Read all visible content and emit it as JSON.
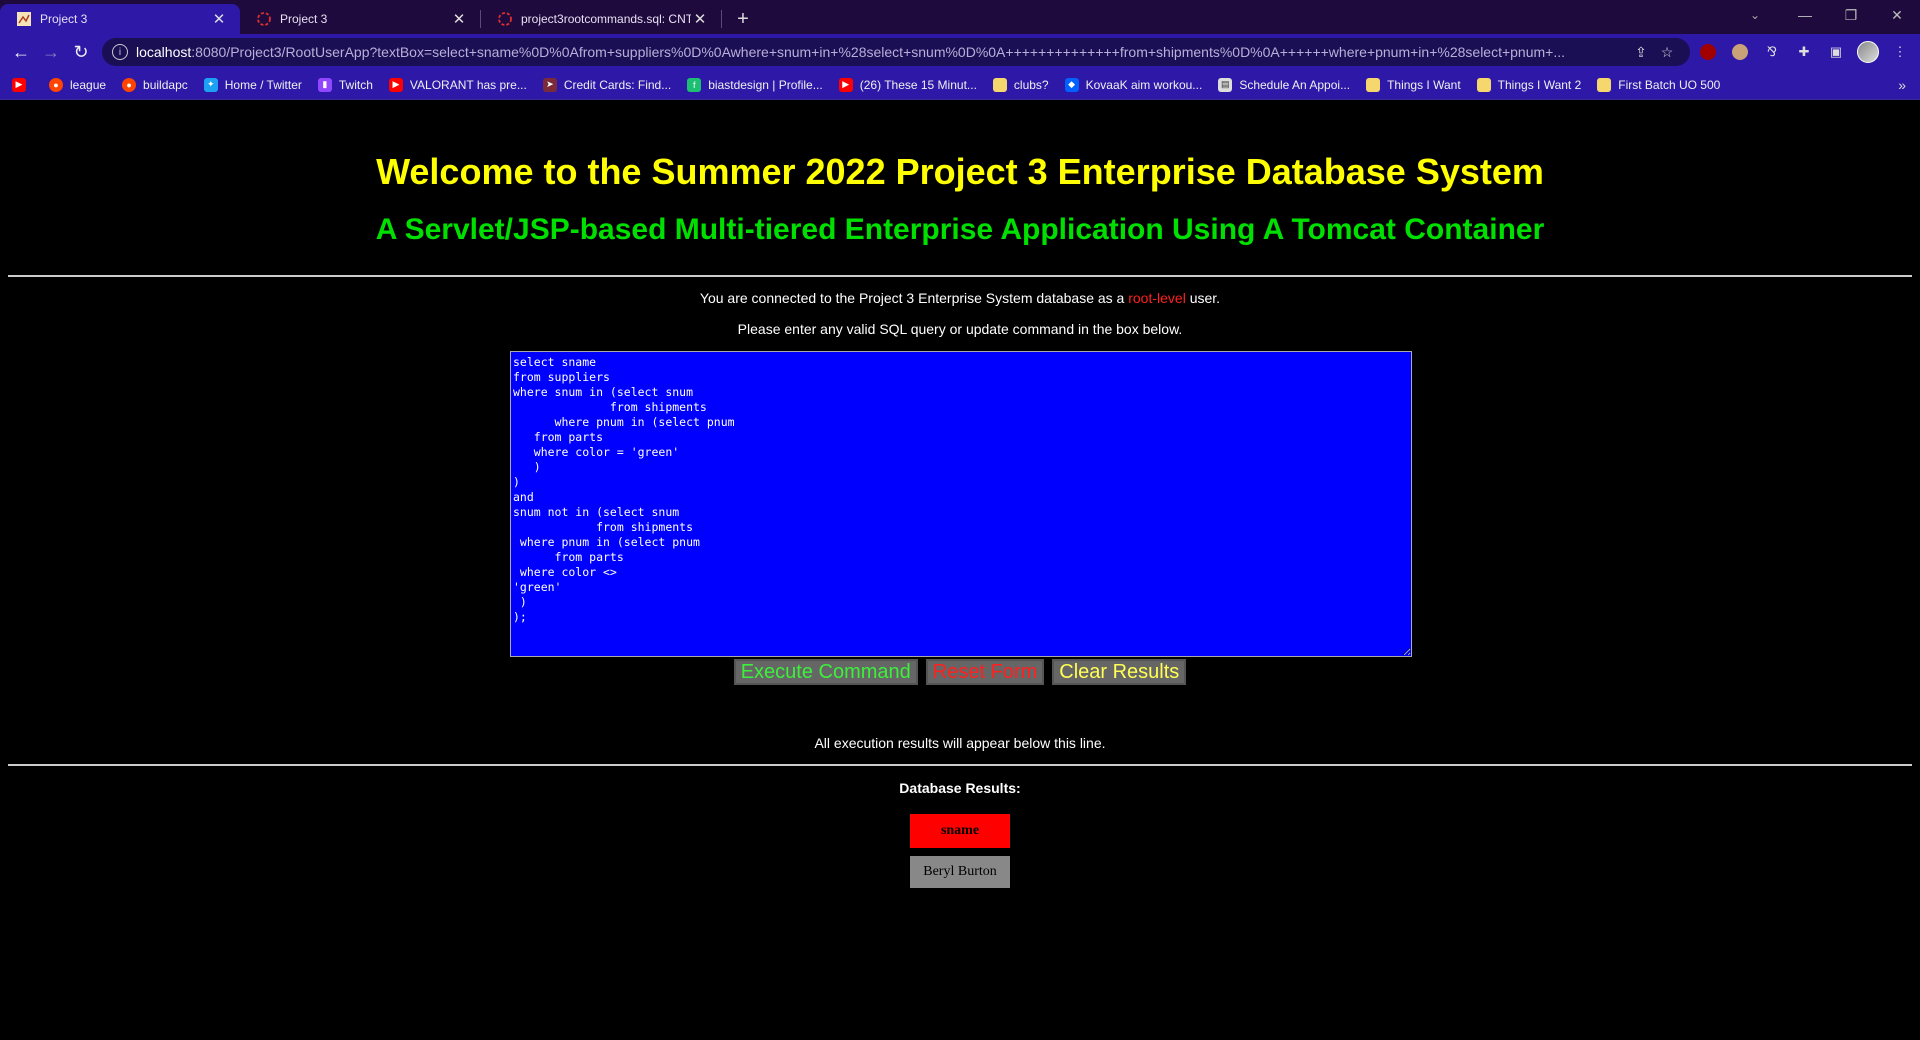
{
  "browser": {
    "tabs": [
      {
        "title": "Project 3",
        "active": true
      },
      {
        "title": "Project 3",
        "active": false
      },
      {
        "title": "project3rootcommands.sql: CNT4",
        "active": false
      }
    ],
    "new_tab": "+",
    "url_host": "localhost",
    "url_rest": ":8080/Project3/RootUserApp?textBox=select+sname%0D%0Afrom+suppliers%0D%0Awhere+snum+in+%28select+snum%0D%0A++++++++++++++from+shipments%0D%0A++++++where+pnum+in+%28select+pnum+...",
    "bookmarks": [
      {
        "label": "",
        "icon": "youtube-icon",
        "color": "#ff0000"
      },
      {
        "label": "league",
        "icon": "reddit-icon",
        "color": "#ff4500"
      },
      {
        "label": "buildapc",
        "icon": "reddit-icon",
        "color": "#ff4500"
      },
      {
        "label": "Home / Twitter",
        "icon": "twitter-icon",
        "color": "#1da1f2"
      },
      {
        "label": "Twitch",
        "icon": "twitch-icon",
        "color": "#9146ff"
      },
      {
        "label": "VALORANT has pre...",
        "icon": "youtube-icon",
        "color": "#ff0000"
      },
      {
        "label": "Credit Cards: Find...",
        "icon": "card-icon",
        "color": "#7b2a3a"
      },
      {
        "label": "biastdesign | Profile...",
        "icon": "fiverr-icon",
        "color": "#1dbf73"
      },
      {
        "label": "(26) These 15 Minut...",
        "icon": "youtube-icon",
        "color": "#ff0000"
      },
      {
        "label": "clubs?",
        "icon": "folder-icon",
        "color": "#f5d76e"
      },
      {
        "label": "KovaaK aim workou...",
        "icon": "dropbox-icon",
        "color": "#0061ff"
      },
      {
        "label": "Schedule An Appoi...",
        "icon": "calendar-icon",
        "color": "#dddddd"
      },
      {
        "label": "Things I Want",
        "icon": "folder-icon",
        "color": "#f5d76e"
      },
      {
        "label": "Things I Want 2",
        "icon": "folder-icon",
        "color": "#f5d76e"
      },
      {
        "label": "First Batch UO 500",
        "icon": "folder-icon",
        "color": "#f5d76e"
      }
    ]
  },
  "page": {
    "title": "Welcome to the Summer 2022 Project 3 Enterprise Database System",
    "subtitle": "A Servlet/JSP-based Multi-tiered Enterprise Application Using A Tomcat Container",
    "connected_pre": "You are connected to the Project 3 Enterprise System database as a ",
    "connected_role": "root-level",
    "connected_post": " user.",
    "instruction": "Please enter any valid SQL query or update command in the box below.",
    "sql_text": "select sname\nfrom suppliers\nwhere snum in (select snum\n              from shipments\n      where pnum in (select pnum\n   from parts\n   where color = 'green'\n   )\n)\nand\nsnum not in (select snum\n            from shipments\n where pnum in (select pnum\n      from parts\n where color <>\n'green'\n )\n);",
    "buttons": {
      "execute": "Execute Command",
      "reset": "Reset Form",
      "clear": "Clear Results"
    },
    "results_note": "All execution results will appear below this line.",
    "results_label": "Database Results:",
    "results_table": {
      "header": "sname",
      "rows": [
        "Beryl Burton"
      ]
    }
  }
}
